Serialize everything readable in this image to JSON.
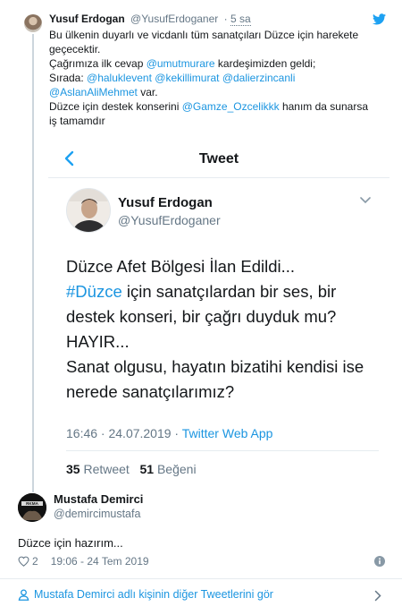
{
  "parent_tweet": {
    "name": "Yusuf Erdogan",
    "handle": "@YusufErdoganer",
    "time": "5 sa",
    "lines": [
      "Bu ülkenin duyarlı ve vicdanlı tüm sanatçıları Düzce için harekete",
      "geçecektir.",
      "Çağrımıza ilk cevap ",
      "@umutmurare",
      " kardeşimizden geldi;",
      "Sırada: ",
      "@haluklevent",
      " ",
      "@kekillimurat",
      " ",
      "@dalierzincanli",
      "@AslanAliMehmet",
      " var.",
      "Düzce için destek konserini ",
      "@Gamze_Ozcelikkk",
      " hanım da sunarsa",
      "iş tamamdır"
    ]
  },
  "screenshot": {
    "title": "Tweet",
    "name": "Yusuf Erdogan",
    "handle": "@YusufErdoganer",
    "text": {
      "line1": "Düzce Afet Bölgesi İlan Edildi...",
      "hashtag": "#Düzce",
      "line2_rest": " için sanatçılardan bir ses, bir",
      "line3": "destek konseri, bir çağrı duyduk mu?",
      "line4": "HAYIR...",
      "line5": "Sanat olgusu, hayatın bizatihi kendisi ise",
      "line6": "nerede sanatçılarımız?"
    },
    "meta_time": "16:46 · 24.07.2019 · ",
    "meta_source": "Twitter Web App",
    "retweets": "35",
    "retweets_label": " Retweet",
    "likes": "51",
    "likes_label": " Beğeni"
  },
  "main_tweet": {
    "name": "Mustafa Demirci",
    "handle": "@demircimustafa",
    "text": "Düzce için hazırım...",
    "likes": "2",
    "timestamp": "19:06 - 24 Tem 2019"
  },
  "more_link": "Mustafa Demirci adlı kişinin diğer Tweetlerini gör",
  "colors": {
    "link": "#1b95e0",
    "muted": "#657786",
    "text": "#14171a",
    "divider": "#e6ecf0"
  }
}
